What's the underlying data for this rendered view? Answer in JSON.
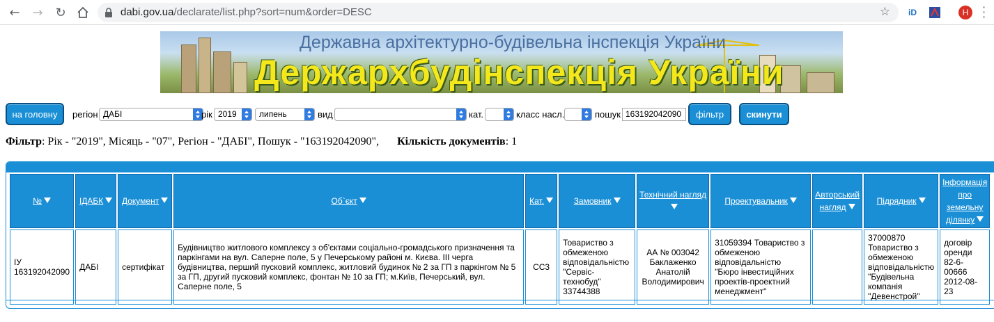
{
  "browser": {
    "url_host": "dabi.gov.ua",
    "url_path": "/declarate/list.php?sort=num&order=DESC",
    "avatar_letter": "H",
    "ext1": "iD"
  },
  "banner": {
    "subtitle": "Державна архітектурно-будівельна інспекція України",
    "title": "Держархбудінспекція України"
  },
  "filters": {
    "home_button": "на головну",
    "region_label": "регіон",
    "region_value": "ДАБІ",
    "year_label": "рік",
    "year_value": "2019",
    "month_value": "липень",
    "type_label": "вид",
    "type_value": "",
    "cat_label": "кат.",
    "cat_value": "",
    "class_label": "класс насл.",
    "class_value": "",
    "search_label": "пошук",
    "search_value": "163192042090",
    "filter_button": "фільтр",
    "reset_button": "скинути"
  },
  "summary": {
    "filter_bold": "Фільтр",
    "filter_text": ": Рік - \"2019\", Місяць - \"07\", Регіон - \"ДАБІ\", Пошук - \"163192042090\",",
    "count_bold": "Кількість документів",
    "count_text": ": 1"
  },
  "table": {
    "headers": [
      "№",
      "ІДАБК",
      "Документ",
      "Об`єкт",
      "Кат.",
      "Замовник",
      "Технічний нагляд",
      "Проектувальник",
      "Авторський нагляд",
      "Підрядник",
      "Інформація про земельну ділянку"
    ],
    "rows": [
      [
        "ІУ 163192042090",
        "ДАБІ",
        "сертифікат",
        "Будівництво житлового комплексу з об'єктами соціально-громадського призначення та паркінгами на вул. Саперне поле, 5 у Печерському районі м. Києва. ІІІ черга будівництва, перший пусковий комплекс, житловий будинок № 2 за ГП з паркінгом № 5 за ГП, другий пусковий комплекс, фонтан № 10 за ГП; м.Київ, Печерський, вул. Саперне поле, 5",
        "СС3",
        "Товариство з обмеженою відповідальністю \"Сервіс-технобуд\" 33744388",
        "АА № 003042 Баклаженко Анатолій Володимирович",
        "31059394 Товариство з обмеженою відповідальністю \"Бюро інвестиційних проектів-проектний менеджмент\"",
        "",
        "37000870 Товариство з обмеженою відповідальністю \"Будівельна компанія \"Девенстрой\"",
        "договір оренди 82-6-00666 2012-08-23"
      ]
    ]
  },
  "colors": {
    "accent": "#1a8fd6",
    "banner_title": "#f4e81c"
  }
}
